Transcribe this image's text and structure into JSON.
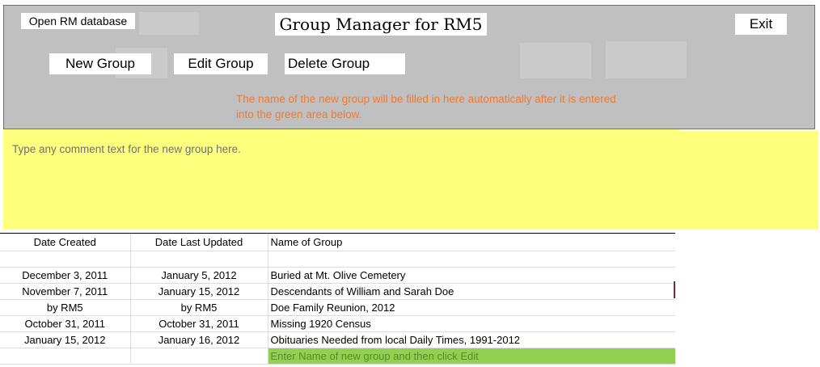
{
  "header": {
    "title": "Group Manager for RM5",
    "open_db_label": "Open RM database",
    "exit_label": "Exit",
    "new_group_label": "New Group",
    "edit_group_label": "Edit Group",
    "delete_group_label": "Delete Group",
    "notice": "The name of the new group will be filled in here automatically after it is entered into the green area below."
  },
  "comment": {
    "placeholder": "Type any comment text for the new group here."
  },
  "table": {
    "columns": [
      "Date Created",
      "Date Last Updated",
      "Name of Group"
    ],
    "rows": [
      {
        "created": "",
        "updated": "",
        "name": ""
      },
      {
        "created": "December 3, 2011",
        "updated": "January 5, 2012",
        "name": "Buried at Mt. Olive Cemetery"
      },
      {
        "created": "November 7, 2011",
        "updated": "January 15, 2012",
        "name": "Descendants of William and Sarah Doe"
      },
      {
        "created": "by RM5",
        "updated": "by RM5",
        "name": "Doe Family Reunion, 2012"
      },
      {
        "created": "October 31, 2011",
        "updated": "October 31, 2011",
        "name": "Missing 1920 Census"
      },
      {
        "created": "January 15, 2012",
        "updated": "January 16, 2012",
        "name": "Obituaries Needed from local Daily Times, 1991-2012"
      }
    ],
    "entry_placeholder": "Enter Name of new group and then click Edit"
  },
  "colors": {
    "panel": "#c0c0c0",
    "comment_area": "#ffff7e",
    "entry_area": "#92d050",
    "notice_text": "#f07a34"
  }
}
